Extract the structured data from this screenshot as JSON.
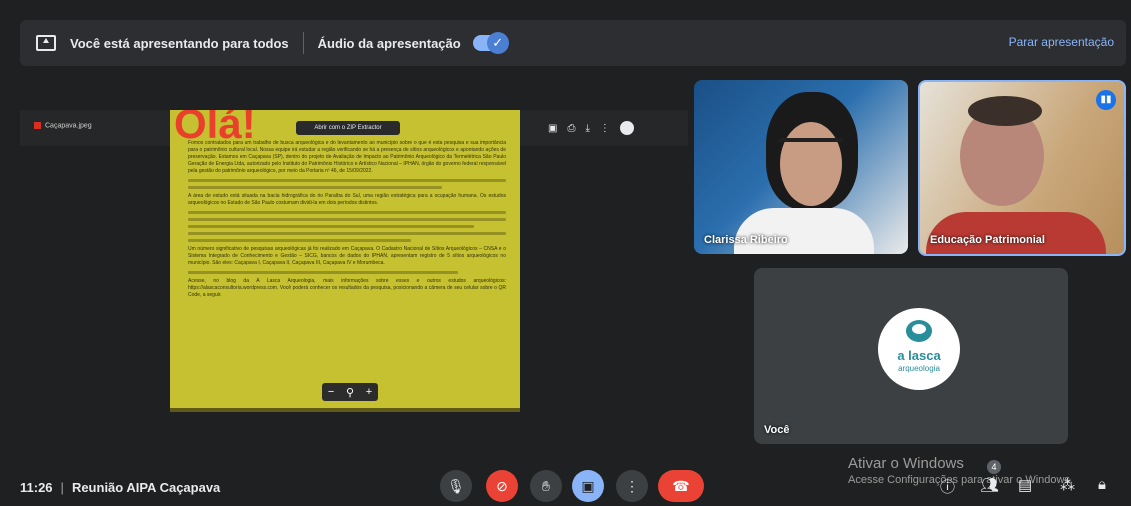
{
  "banner": {
    "presenting_text": "Você está apresentando para todos",
    "audio_label": "Áudio da apresentação",
    "audio_toggle_on": true,
    "stop_label": "Parar apresentação"
  },
  "shared_screen": {
    "file_name": "Caçapava.jpeg",
    "open_with_label": "Abrir com o ZIP Extractor",
    "doc_heading": "Olá!",
    "doc_paragraph_1": "Fomos contratados para um trabalho de busca arqueológica e do levantamento ao município sobre o que é esta pesquisa e sua importância para o patrimônio cultural local. Nossa equipe irá estudar a região verificando se há a presença de sítios arqueológicos e apontando ações de preservação. Estamos em Caçapava (SP), dentro do projeto de Avaliação de Impacto ao Patrimônio Arqueológico da Termelétrica São Paulo Geração de Energia Ltda, autorizado pelo Instituto do Patrimônio Histórico e Artístico Nacional – IPHAN, órgão do governo federal responsável pela gestão do patrimônio arqueológico, por meio da Portaria nº 46, de 15/09/2022.",
    "doc_paragraph_2": "A área de estudo está situada na bacia hidrográfica do rio Paraíba do Sul, uma região estratégica para a ocupação humana. Os estudos arqueológicos no Estado de São Paulo costumam dividi-la em dois períodos distintos.",
    "doc_paragraph_3": "Um número significativo de pesquisas arqueológicas já foi realizado em Caçapava. O Cadastro Nacional de Sítios Arqueológicos – CNSA e o Sistema Integrado de Conhecimento e Gestão – SICG, bancos de dados do IPHAN, apresentam registro de 5 sítios arqueológicos no município. São eles: Caçapava I, Caçapava II, Caçapava III, Caçapava IV e Morumbeca.",
    "doc_paragraph_4": "Acesse, no blog da A Lasca Arqueologia, mais informações sobre esses e outros estudos arqueológicos: https://alascaconsultoria.wordpress.com. Você poderá conhecer os resultados da pesquisa, posicionando a câmera de seu celular sobre o QR Code, a seguir.",
    "zoom_minus": "−",
    "zoom_icon": "zoom-icon",
    "zoom_plus": "+"
  },
  "participants": [
    {
      "name": "Clarissa Ribeiro"
    },
    {
      "name": "Educação Patrimonial",
      "speaking": true
    },
    {
      "name": "Você"
    }
  ],
  "self_tile": {
    "logo_line1": "a lasca",
    "logo_line2": "arqueologia"
  },
  "bottom": {
    "time": "11:26",
    "separator": "|",
    "meeting_name": "Reunião AIPA Caçapava",
    "people_count": "4"
  },
  "watermark": {
    "line1": "Ativar o Windows",
    "line2": "Acesse Configurações para ativar o Windows."
  },
  "colors": {
    "accent": "#8ab4f8",
    "danger": "#ea4335",
    "doc_bg": "#c6c130"
  }
}
